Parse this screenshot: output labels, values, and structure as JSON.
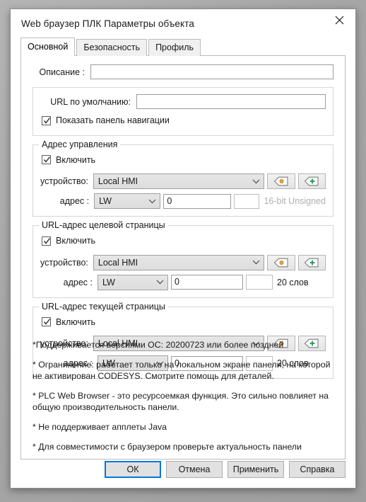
{
  "window": {
    "title": "Web браузер ПЛК Параметры объекта",
    "close_icon": "close-icon"
  },
  "tabs": [
    {
      "label": "Основной",
      "active": true
    },
    {
      "label": "Безопасность",
      "active": false
    },
    {
      "label": "Профиль",
      "active": false
    }
  ],
  "general": {
    "description_label": "Описание :",
    "description_value": "",
    "default_url_label": "URL по умолчанию:",
    "default_url_value": "",
    "show_nav_label": "Показать панель навигации",
    "show_nav_checked": true
  },
  "groups": [
    {
      "legend": "Адрес управления",
      "enable_label": "Включить",
      "enable_checked": true,
      "device_label": "устройство:",
      "device_value": "Local HMI",
      "address_label": "адрес :",
      "address_type": "LW",
      "address_value": "0",
      "address_extra": "",
      "info_text": "16-bit Unsigned",
      "info_muted": true,
      "tag_button": "tag-settings-icon",
      "add_button": "tag-add-icon"
    },
    {
      "legend": "URL-адрес целевой страницы",
      "enable_label": "Включить",
      "enable_checked": true,
      "device_label": "устройство:",
      "device_value": "Local HMI",
      "address_label": "адрес :",
      "address_type": "LW",
      "address_value": "0",
      "address_extra": "",
      "info_text": "20 слов",
      "info_muted": false,
      "tag_button": "tag-settings-icon",
      "add_button": "tag-add-icon"
    },
    {
      "legend": "URL-адрес текущей страницы",
      "enable_label": "Включить",
      "enable_checked": true,
      "device_label": "устройство:",
      "device_value": "Local HMI",
      "address_label": "адрес :",
      "address_type": "LW",
      "address_value": "0",
      "address_extra": "",
      "info_text": "20 слов",
      "info_muted": false,
      "tag_button": "tag-settings-icon",
      "add_button": "tag-add-icon"
    }
  ],
  "notes": [
    "*Поддерживается версиями ОС: 20200723 или более поздней",
    "* Ограничение: работает только на локальном экране панели, на которой не активирован CODESYS. Смотрите помощь для деталей.",
    "* PLC Web Browser - это ресурсоемкая функция. Это сильно повлияет на общую производительность панели.",
    "* Не поддерживает апплеты Java",
    "* Для совместимости с браузером проверьте актуальность панели"
  ],
  "footer": {
    "ok": "ОК",
    "cancel": "Отмена",
    "apply": "Применить",
    "help": "Справка"
  },
  "colors": {
    "accent": "#0078d7",
    "tag_orange": "#e8a33d",
    "tag_green": "#2e9e5b",
    "muted_text": "#b0b0b0"
  }
}
